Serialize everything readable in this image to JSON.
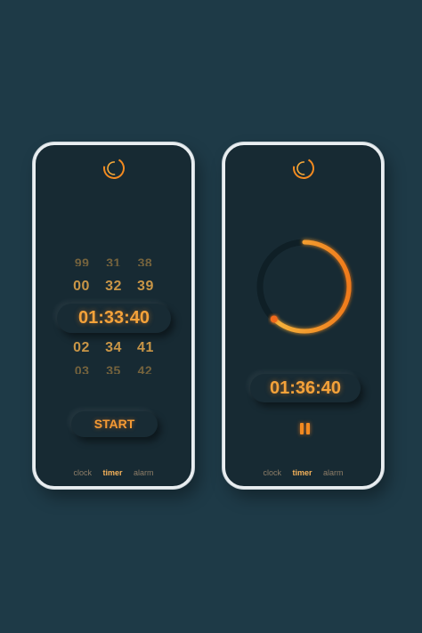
{
  "left_screen": {
    "picker": {
      "row_top_cut": [
        "99",
        "31",
        "38"
      ],
      "row_above": [
        "00",
        "32",
        "39"
      ],
      "selected_time": "01:33:40",
      "row_below": [
        "02",
        "34",
        "41"
      ],
      "row_bottom_cut": [
        "03",
        "35",
        "42"
      ]
    },
    "start_label": "START",
    "tabs": [
      "clock",
      "timer",
      "alarm"
    ],
    "active_tab": "timer"
  },
  "right_screen": {
    "progress_fraction": 0.62,
    "remaining_time": "01:36:40",
    "tabs": [
      "clock",
      "timer",
      "alarm"
    ],
    "active_tab": "timer"
  },
  "colors": {
    "background": "#1e3a47",
    "screen": "#172a33",
    "accent_orange": "#f38a20",
    "accent_yellow": "#f5c043",
    "inactive_tab": "#8e7e68"
  },
  "icons": {
    "logo": "spiral-logo-icon",
    "pause": "pause-icon"
  }
}
